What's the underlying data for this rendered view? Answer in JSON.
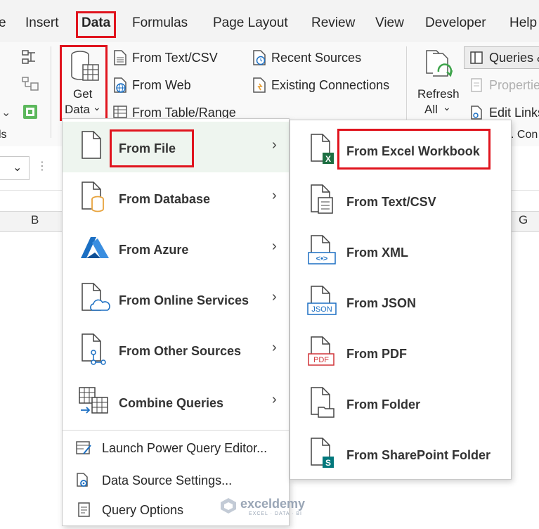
{
  "tabs": [
    "e",
    "Insert",
    "Data",
    "Formulas",
    "Page Layout",
    "Review",
    "View",
    "Developer",
    "Help"
  ],
  "ribbon": {
    "left_label": "ls",
    "get_data": {
      "line1": "Get",
      "line2": "Data",
      "caret": "⌄"
    },
    "from_text_csv": "From Text/CSV",
    "from_web": "From Web",
    "from_table_range": "From Table/Range",
    "recent_sources": "Recent Sources",
    "existing_connections": "Existing Connections",
    "refresh": {
      "line1": "Refresh",
      "line2": "All",
      "caret": "⌄"
    },
    "queries": "Queries &",
    "properties": "Propertie",
    "edit_links": "Edit Links",
    "connections_partial": ". Con"
  },
  "grid": {
    "col_b": "B",
    "col_g": "G"
  },
  "get_data_menu": {
    "items": [
      {
        "label": "From File",
        "underline": "F"
      },
      {
        "label": "From Database",
        "underline": "D"
      },
      {
        "label": "From Azure",
        "underline": "A"
      },
      {
        "label": "From Online Services",
        "underline": "S"
      },
      {
        "label": "From Other Sources",
        "underline": "O"
      },
      {
        "label": "Combine Queries",
        "underline": ""
      }
    ],
    "launch_pq": "Launch Power Query Editor...",
    "data_source_settings": "Data Source Settings...",
    "query_options": "Query Options"
  },
  "from_file_submenu": {
    "items": [
      "From Excel Workbook",
      "From Text/CSV",
      "From XML",
      "From JSON",
      "From PDF",
      "From Folder",
      "From SharePoint Folder"
    ],
    "file_badges": {
      "xml": "<•>",
      "json": "JSON",
      "pdf": "PDF",
      "excel": "X",
      "sharepoint": "S"
    }
  },
  "watermark": {
    "name": "exceldemy",
    "tagline": "EXCEL · DATA · BI"
  },
  "colors": {
    "highlight": "#e0141e",
    "excel_green": "#1d6f42",
    "azure_blue": "#1b6fc3",
    "hover": "#eef5ef"
  }
}
